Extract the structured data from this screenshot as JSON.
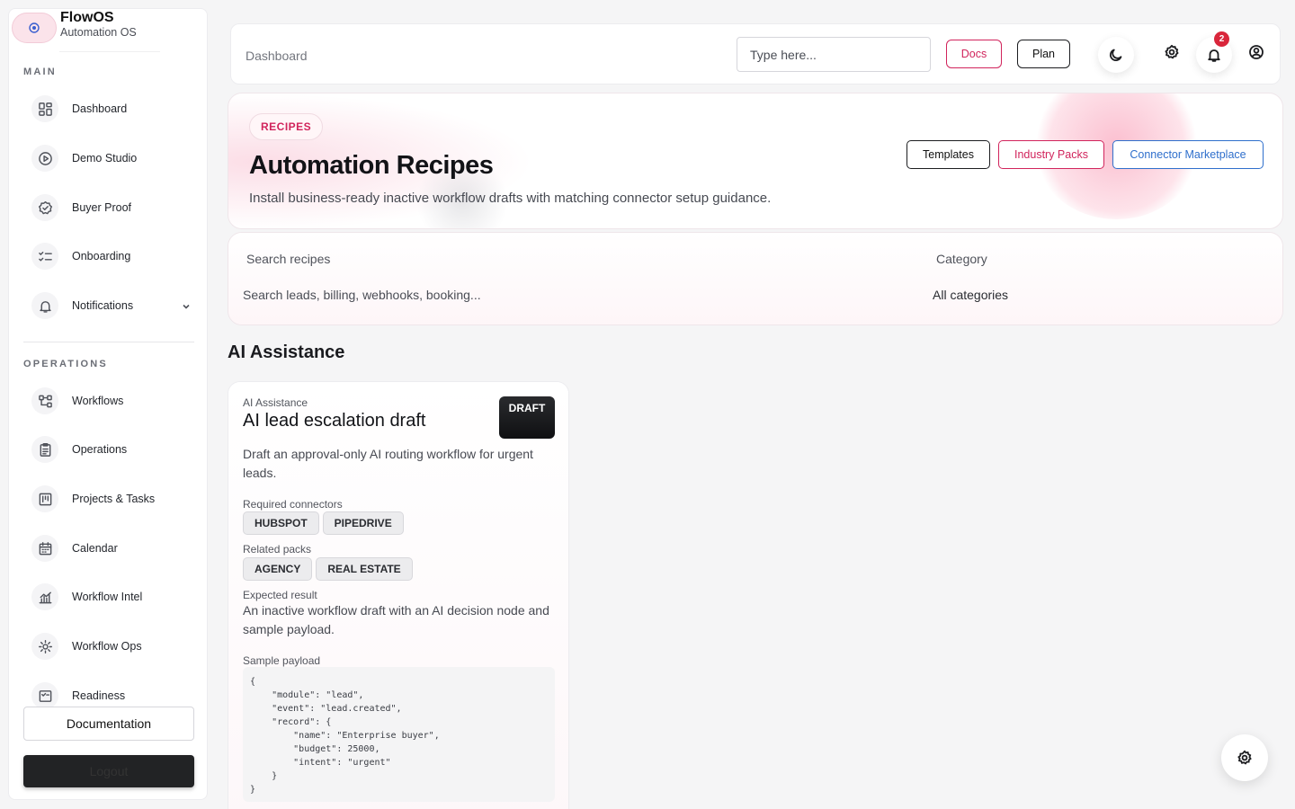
{
  "brand": {
    "name": "FlowOS",
    "subtitle": "Automation OS"
  },
  "sidebar": {
    "sections": [
      {
        "label": "MAIN"
      },
      {
        "label": "OPERATIONS"
      }
    ],
    "main_items": [
      {
        "label": "Dashboard",
        "icon": "dashboard-icon"
      },
      {
        "label": "Demo Studio",
        "icon": "play-icon"
      },
      {
        "label": "Buyer Proof",
        "icon": "badge-check-icon"
      },
      {
        "label": "Onboarding",
        "icon": "checklist-icon"
      },
      {
        "label": "Notifications",
        "icon": "bell-icon"
      }
    ],
    "ops_items": [
      {
        "label": "Workflows",
        "icon": "workflow-icon"
      },
      {
        "label": "Operations",
        "icon": "clipboard-icon"
      },
      {
        "label": "Projects & Tasks",
        "icon": "kanban-icon"
      },
      {
        "label": "Calendar",
        "icon": "calendar-icon"
      },
      {
        "label": "Workflow Intel",
        "icon": "chart-icon"
      },
      {
        "label": "Workflow Ops",
        "icon": "gear-icon"
      },
      {
        "label": "Readiness",
        "icon": "checklist-icon"
      }
    ],
    "documentation_label": "Documentation",
    "logout_label": "Logout"
  },
  "topbar": {
    "breadcrumb": "Dashboard",
    "search_placeholder": "Type here...",
    "docs_label": "Docs",
    "plan_label": "Plan",
    "notification_count": "2"
  },
  "hero": {
    "pill": "RECIPES",
    "title": "Automation Recipes",
    "subtitle": "Install business-ready inactive workflow drafts with matching connector setup guidance.",
    "buttons": {
      "templates": "Templates",
      "industry": "Industry Packs",
      "connector": "Connector Marketplace"
    }
  },
  "filters": {
    "search_label": "Search recipes",
    "search_placeholder": "Search leads, billing, webhooks, booking...",
    "category_label": "Category",
    "category_value": "All categories"
  },
  "section_title": "AI Assistance",
  "card": {
    "kicker": "AI Assistance",
    "title": "AI lead escalation draft",
    "status": "DRAFT",
    "description": "Draft an approval-only AI routing workflow for urgent leads.",
    "connectors_label": "Required connectors",
    "connectors": [
      "HUBSPOT",
      "PIPEDRIVE"
    ],
    "packs_label": "Related packs",
    "packs": [
      "AGENCY",
      "REAL ESTATE"
    ],
    "result_label": "Expected result",
    "result": "An inactive workflow draft with an AI decision node and sample payload.",
    "payload_label": "Sample payload",
    "payload": "{\n    \"module\": \"lead\",\n    \"event\": \"lead.created\",\n    \"record\": {\n        \"name\": \"Enterprise buyer\",\n        \"budget\": 25000,\n        \"intent\": \"urgent\"\n    }\n}"
  },
  "colors": {
    "accent_pink": "#d1245c",
    "accent_blue": "#2f6fcc",
    "badge_red": "#d9263b"
  }
}
